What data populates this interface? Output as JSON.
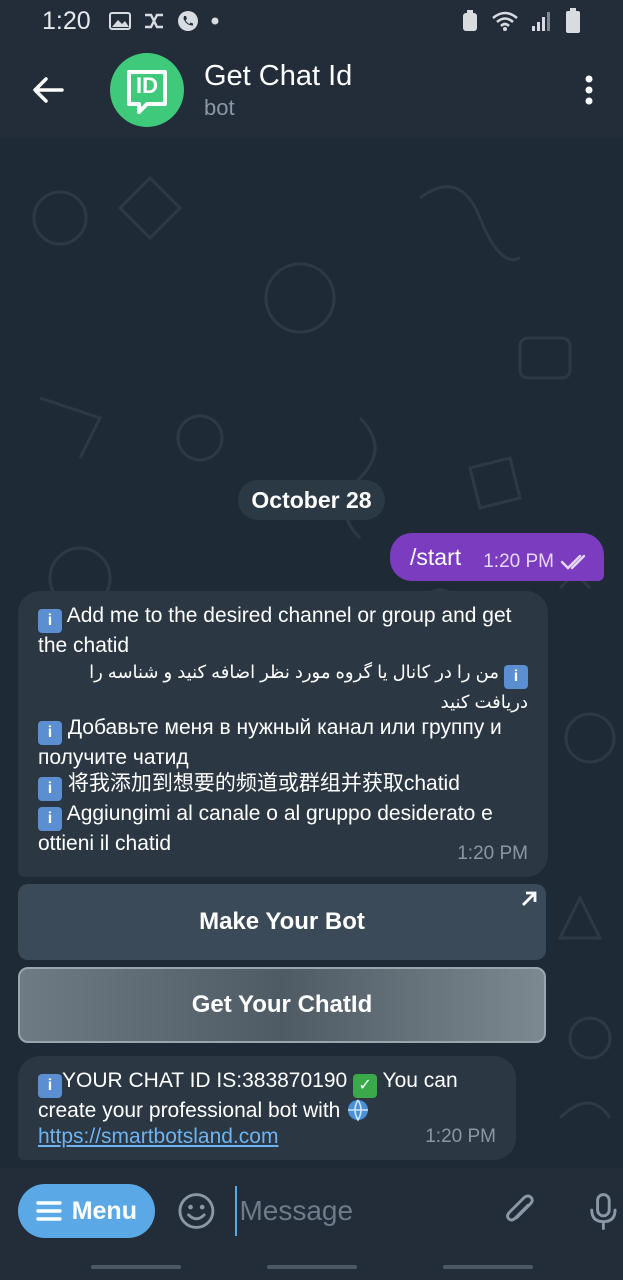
{
  "status_bar": {
    "time": "1:20"
  },
  "header": {
    "title": "Get Chat Id",
    "subtitle": "bot",
    "avatar_text": "ID"
  },
  "chat": {
    "date_chip": "October 28",
    "outgoing": {
      "text": "/start",
      "time": "1:20 PM"
    },
    "incoming_1": {
      "lines": [
        "Add me to the desired channel or group and get the chatid",
        "من را در کانال یا گروه مورد نظر اضافه کنید و شناسه  را دریافت کنید",
        "Добавьте меня в нужный канал или группу и получите чатид",
        "将我添加到想要的频道或群组并获取chatid",
        "Aggiungimi al canale o al gruppo desiderato e ottieni il chatid"
      ],
      "info_mark": "i",
      "time": "1:20 PM"
    },
    "keyboard": {
      "make_bot": "Make Your Bot",
      "get_chatid": "Get Your ChatId"
    },
    "incoming_2": {
      "line1": "YOUR CHAT ID IS:383870190",
      "line2": "You can create your professional bot with",
      "link": "https://smartbotsland.com",
      "time": "1:20 PM"
    }
  },
  "composer": {
    "menu_label": "Menu",
    "placeholder": "Message"
  },
  "colors": {
    "accent": "#5aa9e6",
    "outgoing": "#7b3cc0",
    "avatar": "#3fca7b"
  }
}
